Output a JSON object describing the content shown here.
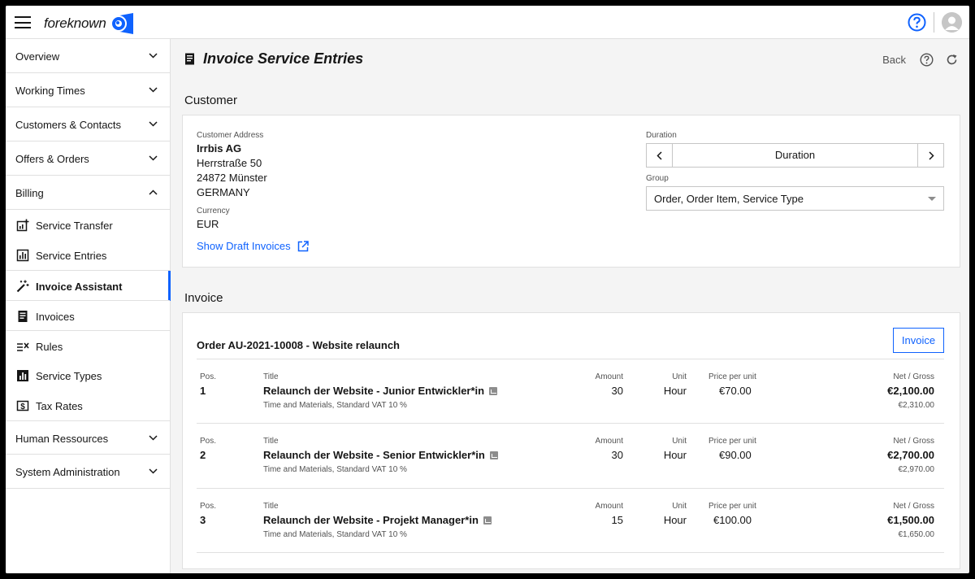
{
  "app": {
    "name": "foreknown"
  },
  "sidebar": {
    "groups_top": [
      {
        "label": "Overview"
      },
      {
        "label": "Working Times"
      },
      {
        "label": "Customers & Contacts"
      },
      {
        "label": "Offers & Orders"
      }
    ],
    "billing": {
      "label": "Billing",
      "items": [
        {
          "label": "Service Transfer",
          "icon": "service-transfer-icon"
        },
        {
          "label": "Service Entries",
          "icon": "service-entries-icon"
        },
        {
          "label": "Invoice Assistant",
          "icon": "magic-wand-icon",
          "active": true
        },
        {
          "label": "Invoices",
          "icon": "invoice-icon"
        },
        {
          "label": "Rules",
          "icon": "rules-icon"
        },
        {
          "label": "Service Types",
          "icon": "service-types-icon"
        },
        {
          "label": "Tax Rates",
          "icon": "tax-rates-icon"
        }
      ]
    },
    "groups_bottom": [
      {
        "label": "Human Ressources"
      },
      {
        "label": "System Administration"
      }
    ]
  },
  "header": {
    "title": "Invoice Service Entries",
    "back": "Back"
  },
  "customer": {
    "section_label": "Customer",
    "address_label": "Customer Address",
    "name": "Irrbis AG",
    "street": "Herrstraße 50",
    "city": "24872 Münster",
    "country": "GERMANY",
    "currency_label": "Currency",
    "currency": "EUR",
    "draft_link": "Show Draft Invoices",
    "duration_label": "Duration",
    "duration_value": "Duration",
    "group_label": "Group",
    "group_value": "Order, Order Item, Service Type"
  },
  "invoice": {
    "section_label": "Invoice",
    "order_title": "Order AU-2021-10008 - Website relaunch",
    "invoice_button": "Invoice",
    "headers": {
      "pos": "Pos.",
      "title": "Title",
      "amount": "Amount",
      "unit": "Unit",
      "price": "Price per unit",
      "net_gross": "Net / Gross"
    },
    "rows": [
      {
        "pos": "1",
        "title": "Relaunch der Website - Junior Entwickler*in",
        "sub": "Time and Materials, Standard VAT 10 %",
        "amount": "30",
        "unit": "Hour",
        "price": "€70.00",
        "net": "€2,100.00",
        "gross": "€2,310.00"
      },
      {
        "pos": "2",
        "title": "Relaunch der Website - Senior Entwickler*in",
        "sub": "Time and Materials, Standard VAT 10 %",
        "amount": "30",
        "unit": "Hour",
        "price": "€90.00",
        "net": "€2,700.00",
        "gross": "€2,970.00"
      },
      {
        "pos": "3",
        "title": "Relaunch der Website - Projekt Manager*in",
        "sub": "Time and Materials, Standard VAT 10 %",
        "amount": "15",
        "unit": "Hour",
        "price": "€100.00",
        "net": "€1,500.00",
        "gross": "€1,650.00"
      }
    ]
  },
  "colors": {
    "accent": "#0f62fe",
    "text": "#161616",
    "muted": "#525252",
    "border": "#e0e0e0"
  }
}
